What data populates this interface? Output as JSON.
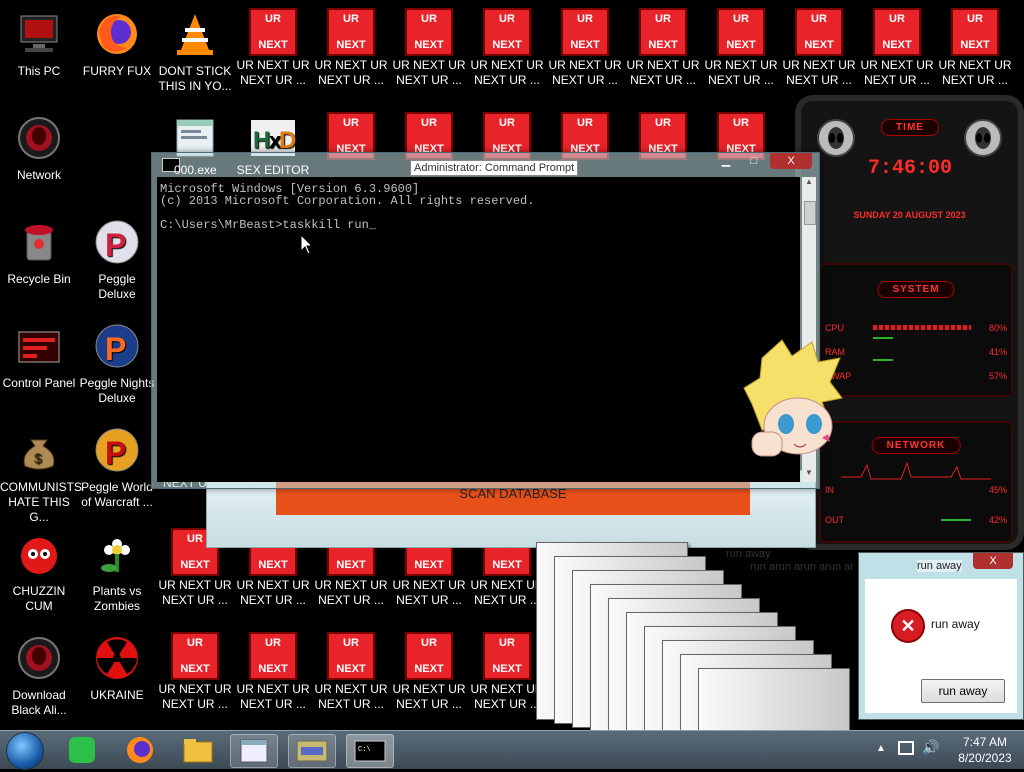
{
  "desktop_icons": [
    {
      "label": "This PC",
      "icon": "computer-icon"
    },
    {
      "label": "FURRY FUX",
      "icon": "firefox-icon"
    },
    {
      "label": "DONT STICK THIS IN YO...",
      "icon": "vlc-cone-icon"
    },
    {
      "label": "Network",
      "icon": "network-alien-icon"
    },
    {
      "label": "SEX EDITOR",
      "icon": "hex-editor-icon"
    },
    {
      "label": "Recycle Bin",
      "icon": "recycle-bin-icon"
    },
    {
      "label": "Peggle Deluxe",
      "icon": "peggle-icon"
    },
    {
      "label": "Control Panel",
      "icon": "control-panel-icon"
    },
    {
      "label": "Peggle Nights Deluxe",
      "icon": "peggle-nights-icon"
    },
    {
      "label": "COMMUNISTS HATE THIS G...",
      "icon": "money-bag-icon"
    },
    {
      "label": "Peggle World of Warcraft ...",
      "icon": "peggle-wow-icon"
    },
    {
      "label": "CHUZZIN CUM",
      "icon": "chuzzle-icon"
    },
    {
      "label": "Plants vs Zombies",
      "icon": "pvz-flower-icon"
    },
    {
      "label": "Download Black Ali...",
      "icon": "alien-download-icon"
    },
    {
      "label": "UKRAINE",
      "icon": "radiation-icon"
    }
  ],
  "ur_next": {
    "top": "UR",
    "bottom": "NEXT",
    "label1": "UR NEXT UR",
    "label2": "NEXT UR ..."
  },
  "desktop_partial_labels": {
    "exe": "000.exe",
    "next_ur": "NEXT UR",
    "ur_ne": "UR NE"
  },
  "cmd": {
    "title": "Administrator: Command Prompt",
    "line1": "Microsoft Windows [Version 6.3.9600]",
    "line2": "(c) 2013 Microsoft Corporation. All rights reserved.",
    "prompt": "C:\\Users\\MrBeast>taskkill run_"
  },
  "scan_button": "SCAN DATABASE",
  "widget": {
    "time_title": "TIME",
    "time": "7:46:00",
    "date": "SUNDAY 20 AUGUST 2023",
    "system_title": "SYSTEM",
    "cpu_label": "CPU",
    "cpu_value": "80%",
    "ram_label": "RAM",
    "ram_value": "41%",
    "swap_label": "SWAP",
    "swap_value": "57%",
    "network_title": "NETWORK",
    "in_label": "IN",
    "in_value": "45%",
    "out_label": "OUT",
    "out_value": "42%"
  },
  "run_away": {
    "title": "run away",
    "message": "run away",
    "button": "run away",
    "stack_text": "run away",
    "stack_row": "run arun arun arun ar"
  },
  "window_controls": {
    "minimize": "▁",
    "maximize": "□",
    "close": "X"
  },
  "taskbar": {
    "time": "7:47 AM",
    "date": "8/20/2023"
  },
  "colors": {
    "ur_red": "#e8232a",
    "widget_red": "#ff2a2a",
    "scan_orange": "#e8501a"
  }
}
